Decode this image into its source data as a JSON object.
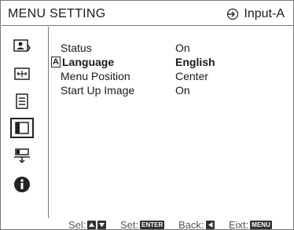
{
  "header": {
    "title": "MENU SETTING",
    "input_label": "Input-A",
    "input_icon": "input-arrow-icon"
  },
  "sidebar": {
    "items": [
      {
        "name": "picture-icon",
        "selected": false
      },
      {
        "name": "screen-icon",
        "selected": false
      },
      {
        "name": "function-icon",
        "selected": false
      },
      {
        "name": "menu-setting-icon",
        "selected": true
      },
      {
        "name": "installation-icon",
        "selected": false
      },
      {
        "name": "information-icon",
        "selected": false
      }
    ]
  },
  "menu": {
    "rows": [
      {
        "label": "Status",
        "value": "On"
      },
      {
        "label": "Language",
        "value": "English",
        "cursor": "A"
      },
      {
        "label": "Menu Position",
        "value": "Center"
      },
      {
        "label": "Start Up Image",
        "value": "On"
      }
    ]
  },
  "footer": {
    "sel_label": "Sel:",
    "set_label": "Set:",
    "set_key": "ENTER",
    "back_label": "Back:",
    "exit_label": "Eixt:",
    "exit_key": "MENU"
  }
}
